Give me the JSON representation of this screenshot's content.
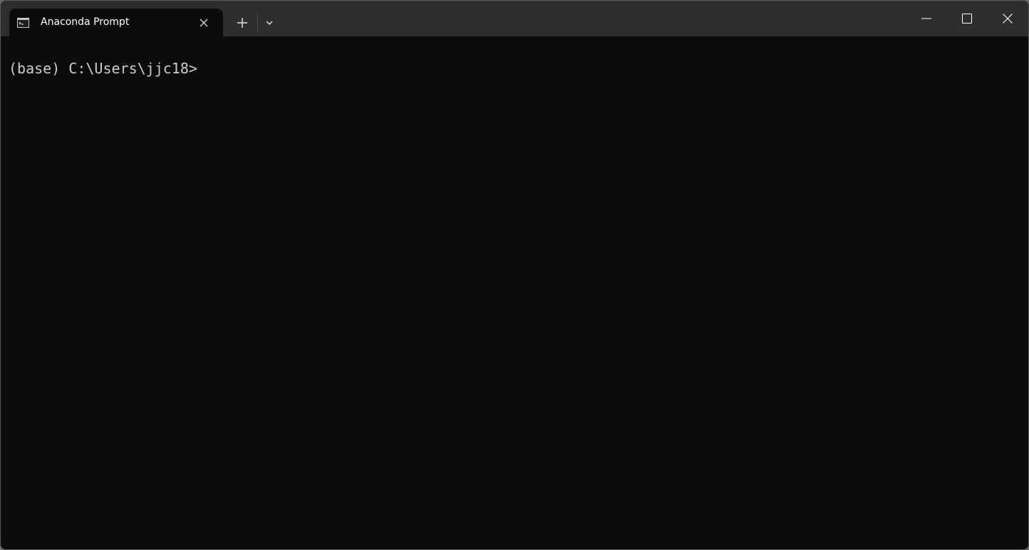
{
  "window": {
    "tab_title": "Anaconda Prompt",
    "tab_icon": "terminal-icon"
  },
  "toolbar": {
    "new_tab_icon": "plus-icon",
    "dropdown_icon": "chevron-down-icon"
  },
  "caption": {
    "minimize_icon": "minimize-icon",
    "maximize_icon": "maximize-icon",
    "close_icon": "close-icon"
  },
  "terminal": {
    "prompt": "(base) C:\\Users\\jjc18>",
    "background": "#0c0c0c",
    "foreground": "#cccccc"
  }
}
